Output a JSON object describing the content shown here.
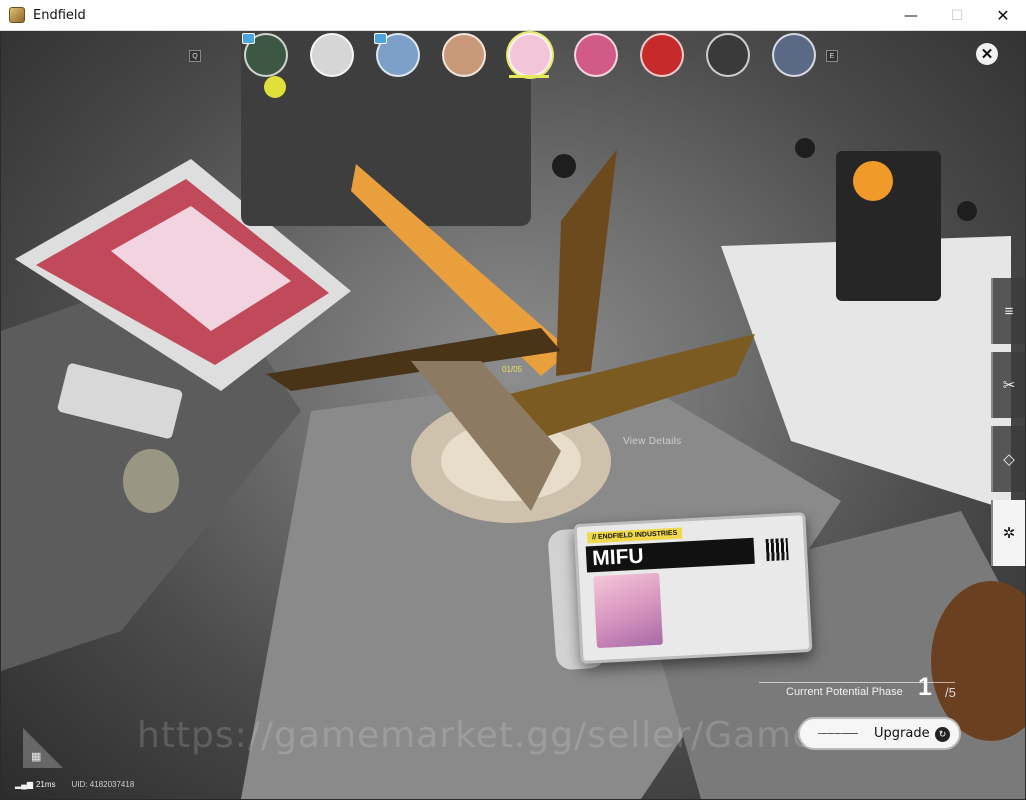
{
  "window": {
    "title": "Endfield",
    "minimize": "—",
    "maximize": "☐",
    "close": "✕"
  },
  "top_bar": {
    "search_key": "Q",
    "next_key": "E",
    "characters": [
      {
        "icon": "operator-portrait-1",
        "badge": true
      },
      {
        "icon": "operator-portrait-2",
        "badge": false
      },
      {
        "icon": "operator-portrait-3",
        "badge": true
      },
      {
        "icon": "operator-portrait-4",
        "badge": false
      },
      {
        "icon": "operator-portrait-mifu",
        "badge": false,
        "active": true
      },
      {
        "icon": "operator-portrait-6",
        "badge": false
      },
      {
        "icon": "operator-portrait-7",
        "badge": false
      },
      {
        "icon": "operator-portrait-8",
        "badge": false
      },
      {
        "icon": "operator-portrait-9",
        "badge": false
      }
    ],
    "close_glyph": "✕"
  },
  "side_tabs": [
    {
      "icon": "menu-lines-icon",
      "glyph": "≡"
    },
    {
      "icon": "crossed-blades-icon",
      "glyph": "✂"
    },
    {
      "icon": "diamond-icon",
      "glyph": "◇"
    },
    {
      "icon": "star-sigil-icon",
      "glyph": "✲",
      "active": true
    }
  ],
  "hud": {
    "phase_counter": "01/05",
    "view_details": "View Details"
  },
  "card": {
    "company": "// ENDFIELD INDUSTRIES",
    "name": "MIFU"
  },
  "potential": {
    "label": "Current Potential Phase",
    "current": "1",
    "total": "/5",
    "upgrade_label": "Upgrade"
  },
  "watermark": "https://gamemarket.gg/seller/GameM",
  "status": {
    "ping": "21ms",
    "uid": "UID: 4182037418"
  },
  "colors": {
    "accent": "#e6e85a",
    "background": "#2b2b2b"
  }
}
